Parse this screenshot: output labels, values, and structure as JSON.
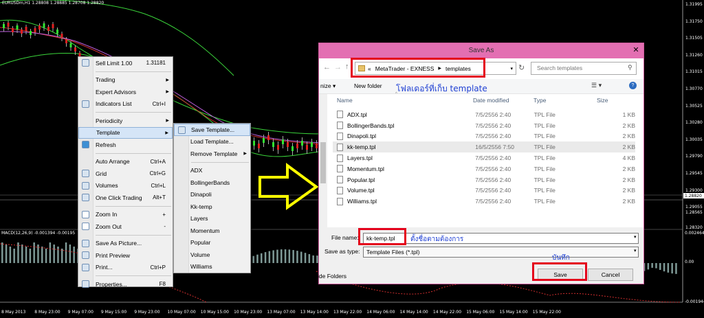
{
  "chart": {
    "symbol": "EURUSDm,H1",
    "ohlc": "1.28808 1.28885 1.28708 1.28820",
    "price_levels": [
      "1.31995",
      "1.31750",
      "1.31505",
      "1.31260",
      "1.31015",
      "1.30770",
      "1.30525",
      "1.30280",
      "1.30035",
      "1.29790",
      "1.29545",
      "1.29300",
      "1.29055",
      "1.28810",
      "1.28820",
      "1.28565",
      "1.28320"
    ],
    "macd_label": "MACD(12,26,9) -0.001394 -0.00195",
    "macd_levels": [
      "0.002464",
      "0.00",
      "-0.001944"
    ],
    "time_labels": [
      "8 May 2013",
      "8 May 23:00",
      "9 May 07:00",
      "9 May 15:00",
      "9 May 23:00",
      "10 May 07:00",
      "10 May 15:00",
      "10 May 23:00",
      "13 May 07:00",
      "13 May 14:00",
      "13 May 22:00",
      "14 May 06:00",
      "14 May 14:00",
      "14 May 22:00",
      "15 May 06:00",
      "15 May 14:00",
      "15 May 22:00"
    ]
  },
  "context_menu": {
    "items": [
      {
        "label": "Sell Limit 1.00",
        "shortcut": "1.31181",
        "icon": "sell-limit-icon"
      },
      {
        "sep": true
      },
      {
        "label": "Trading",
        "arrow": true
      },
      {
        "label": "Expert Advisors",
        "arrow": true
      },
      {
        "label": "Indicators List",
        "shortcut": "Ctrl+I",
        "icon": "indicators-icon"
      },
      {
        "sep": true
      },
      {
        "label": "Periodicity",
        "arrow": true
      },
      {
        "label": "Template",
        "arrow": true,
        "highlight": true
      },
      {
        "label": "Refresh",
        "icon": "refresh-icon"
      },
      {
        "sep": true
      },
      {
        "label": "Auto Arrange",
        "shortcut": "Ctrl+A"
      },
      {
        "label": "Grid",
        "shortcut": "Ctrl+G",
        "icon": "grid-icon"
      },
      {
        "label": "Volumes",
        "shortcut": "Ctrl+L",
        "icon": "volumes-icon"
      },
      {
        "label": "One Click Trading",
        "shortcut": "Alt+T",
        "icon": "one-click-icon"
      },
      {
        "sep": true
      },
      {
        "label": "Zoom In",
        "shortcut": "+",
        "icon": "zoom-in-icon"
      },
      {
        "label": "Zoom Out",
        "shortcut": "-",
        "icon": "zoom-out-icon"
      },
      {
        "sep": true
      },
      {
        "label": "Save As Picture...",
        "icon": "picture-icon"
      },
      {
        "label": "Print Preview",
        "icon": "print-preview-icon"
      },
      {
        "label": "Print...",
        "shortcut": "Ctrl+P",
        "icon": "print-icon"
      },
      {
        "sep": true
      },
      {
        "label": "Properties...",
        "shortcut": "F8",
        "icon": "properties-icon"
      }
    ]
  },
  "template_submenu": {
    "items": [
      {
        "label": "Save Template...",
        "highlight": true,
        "icon": "save-template-icon"
      },
      {
        "label": "Load Template..."
      },
      {
        "label": "Remove Template",
        "arrow": true
      },
      {
        "sep": true
      },
      {
        "label": "ADX"
      },
      {
        "label": "BollingerBands"
      },
      {
        "label": "Dinapoli"
      },
      {
        "label": "Kk-temp"
      },
      {
        "label": "Layers"
      },
      {
        "label": "Momentum"
      },
      {
        "label": "Popular"
      },
      {
        "label": "Volume"
      },
      {
        "label": "Williams"
      }
    ]
  },
  "dialog": {
    "title": "Save As",
    "close": "✕",
    "breadcrumb": {
      "prefix": "«",
      "part1": "MetaTrader - EXNESS",
      "part2": "templates"
    },
    "search_placeholder": "Search templates",
    "organize": "nize ▾",
    "new_folder": "New folder",
    "columns": {
      "name": "Name",
      "date": "Date modified",
      "type": "Type",
      "size": "Size"
    },
    "files": [
      {
        "name": "ADX.tpl",
        "date": "7/5/2556 2:40",
        "type": "TPL File",
        "size": "1 KB"
      },
      {
        "name": "BollingerBands.tpl",
        "date": "7/5/2556 2:40",
        "type": "TPL File",
        "size": "2 KB"
      },
      {
        "name": "Dinapoli.tpl",
        "date": "7/5/2556 2:40",
        "type": "TPL File",
        "size": "2 KB"
      },
      {
        "name": "kk-temp.tpl",
        "date": "16/5/2556 7:50",
        "type": "TPL File",
        "size": "2 KB",
        "selected": true
      },
      {
        "name": "Layers.tpl",
        "date": "7/5/2556 2:40",
        "type": "TPL File",
        "size": "4 KB"
      },
      {
        "name": "Momentum.tpl",
        "date": "7/5/2556 2:40",
        "type": "TPL File",
        "size": "2 KB"
      },
      {
        "name": "Popular.tpl",
        "date": "7/5/2556 2:40",
        "type": "TPL File",
        "size": "2 KB"
      },
      {
        "name": "Volume.tpl",
        "date": "7/5/2556 2:40",
        "type": "TPL File",
        "size": "2 KB"
      },
      {
        "name": "Williams.tpl",
        "date": "7/5/2556 2:40",
        "type": "TPL File",
        "size": "2 KB"
      }
    ],
    "file_name_label": "File name:",
    "file_name_value": "kk-temp.tpl",
    "save_type_label": "Save as type:",
    "save_type_value": "Template Files (*.tpl)",
    "hide_folders": "ide Folders",
    "save": "Save",
    "cancel": "Cancel"
  },
  "annotations": {
    "folder_note": "โฟลเดอร์ที่เก็บ template",
    "name_note": "ตั้งชื่อตามต้องการ",
    "save_note": "บันทึก"
  },
  "colors": {
    "annotation_red": "#e4001b",
    "annotation_blue": "#1e3fd3",
    "arrow_yellow": "#ffff00",
    "title_pink": "#e36fb2"
  }
}
